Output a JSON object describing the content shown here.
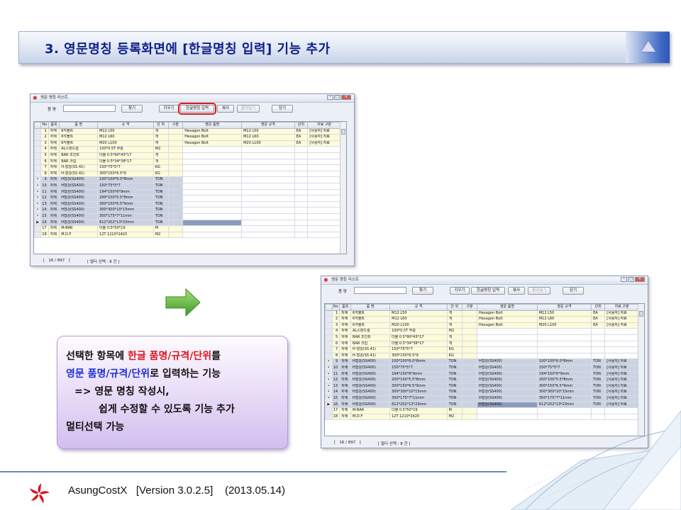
{
  "banner": {
    "title": "3. 영문명칭 등록화면에 [한글명칭 입력] 기능 추가",
    "collapse_icon": "triangle-up-icon"
  },
  "window": {
    "title": "영문 명칭 리스트",
    "name_label": "품 명",
    "buttons": {
      "find": "찾기",
      "clear": "지우기",
      "korean_input": "한글명칭 입력",
      "copy": "복사",
      "paste": "붙여넣기",
      "close": "닫기"
    },
    "columns": [
      "No",
      "품목",
      "품 명",
      "규 격",
      "단 위",
      "구분",
      "영문 품명",
      "영문 규격",
      "단위",
      "자료 구분"
    ],
    "rows": [
      {
        "no": "1",
        "cat": "자재",
        "name": "6각볼트",
        "spec": "M12 L50",
        "unit": "개",
        "div": "",
        "en_name": "Hexagon Bolt",
        "en_spec": "M12 L50",
        "en_unit": "EA",
        "src": "[사용자] 자료"
      },
      {
        "no": "2",
        "cat": "자재",
        "name": "6각볼트",
        "spec": "M12 L60",
        "unit": "개",
        "div": "",
        "en_name": "Hexagon Bolt",
        "en_spec": "M12 L60",
        "en_unit": "EA",
        "src": "[사용자] 자료"
      },
      {
        "no": "3",
        "cat": "자재",
        "name": "6각볼트",
        "spec": "M20 L100",
        "unit": "개",
        "div": "",
        "en_name": "Hexagon Bolt",
        "en_spec": "M20 L100",
        "en_unit": "EA",
        "src": "[사용자] 자료"
      },
      {
        "no": "4",
        "cat": "자재",
        "name": "AL스판드럴",
        "spec": "100*0.5T 무광",
        "unit": "M2",
        "div": "",
        "en_name": "",
        "en_spec": "",
        "en_unit": "",
        "src": ""
      },
      {
        "no": "5",
        "cat": "자재",
        "name": "BAR 조인트",
        "spec": "더블 0.5*90*43*17",
        "unit": "개",
        "div": "",
        "en_name": "",
        "en_spec": "",
        "en_unit": "",
        "src": ""
      },
      {
        "no": "6",
        "cat": "자재",
        "name": "BAR 크립",
        "spec": "더블 0.5*34*38*17",
        "unit": "개",
        "div": "",
        "en_name": "",
        "en_spec": "",
        "en_unit": "",
        "src": ""
      },
      {
        "no": "7",
        "cat": "자재",
        "name": "H-형강(SS 41)",
        "spec": "150*75*5*7",
        "unit": "KG",
        "div": "",
        "en_name": "",
        "en_spec": "",
        "en_unit": "",
        "src": ""
      },
      {
        "no": "8",
        "cat": "자재",
        "name": "H-형강(SS 41)",
        "spec": "300*150*6.5*9",
        "unit": "KG",
        "div": "",
        "en_name": "",
        "en_spec": "",
        "en_unit": "",
        "src": ""
      },
      {
        "no": "9",
        "cat": "자재",
        "name": "H형강(SS400)",
        "spec": "100*100*6.0*8mm",
        "unit": "TON",
        "div": "",
        "en_name": "H형강(SS400)",
        "en_spec": "100*100*6.0*8mm",
        "en_unit": "TON",
        "src": "[사용자] 자료"
      },
      {
        "no": "10",
        "cat": "자재",
        "name": "H형강(SS400)",
        "spec": "150*75*5*7",
        "unit": "TON",
        "div": "",
        "en_name": "H형강(SS400)",
        "en_spec": "150*75*5*7",
        "en_unit": "TON",
        "src": "[사용자] 자료"
      },
      {
        "no": "11",
        "cat": "자재",
        "name": "H형강(SS400)",
        "spec": "194*150*6*9mm",
        "unit": "TON",
        "div": "",
        "en_name": "H형강(SS400)",
        "en_spec": "194*150*6*9mm",
        "en_unit": "TON",
        "src": "[사용자] 자료"
      },
      {
        "no": "12",
        "cat": "자재",
        "name": "H형강(SS400)",
        "spec": "200*100*5.5*8mm",
        "unit": "TON",
        "div": "",
        "en_name": "H형강(SS400)",
        "en_spec": "200*100*5.5*8mm",
        "en_unit": "TON",
        "src": "[사용자] 자료"
      },
      {
        "no": "13",
        "cat": "자재",
        "name": "H형강(SS400)",
        "spec": "300*150*6.5*9mm",
        "unit": "TON",
        "div": "",
        "en_name": "H형강(SS400)",
        "en_spec": "300*150*6.5*9mm",
        "en_unit": "TON",
        "src": "[사용자] 자료"
      },
      {
        "no": "14",
        "cat": "자재",
        "name": "H형강(SS400)",
        "spec": "300*300*10*15mm",
        "unit": "TON",
        "div": "",
        "en_name": "H형강(SS400)",
        "en_spec": "300*300*10*15mm",
        "en_unit": "TON",
        "src": "[사용자] 자료"
      },
      {
        "no": "15",
        "cat": "자재",
        "name": "H형강(SS400)",
        "spec": "350*175*7*11mm",
        "unit": "TON",
        "div": "",
        "en_name": "H형강(SS400)",
        "en_spec": "350*175*7*11mm",
        "en_unit": "TON",
        "src": "[사용자] 자료"
      },
      {
        "no": "16",
        "cat": "자재",
        "name": "H형강(SS400)",
        "spec": "612*202*13*23mm",
        "unit": "TON",
        "div": "",
        "en_name": "H형강(SS400)",
        "en_spec": "612*202*13*23mm",
        "en_unit": "TON",
        "src": "[사용자] 자료"
      },
      {
        "no": "17",
        "cat": "자재",
        "name": "M-BAR",
        "spec": "더블 0.5*50*19",
        "unit": "M",
        "div": "",
        "en_name": "",
        "en_spec": "",
        "en_unit": "",
        "src": ""
      },
      {
        "no": "18",
        "cat": "자재",
        "name": "M.D.F",
        "spec": "12T 1210*2420",
        "unit": "M2",
        "div": "",
        "en_name": "",
        "en_spec": "",
        "en_unit": "",
        "src": ""
      }
    ],
    "status_count": "[   16 / 897   ]",
    "status_multi": "[ 멀티 선택 : 8 건 ]"
  },
  "note": {
    "l1_a": "선택한 항목에 ",
    "l1_b": "한글 품명/규격/단위",
    "l1_c": "를",
    "l2_a": "영문 품명/규격/단위",
    "l2_b": "로 입력하는 기능",
    "l3": "=>  영문 명칭 작성시,",
    "l4": "쉽게 수정할 수 있도록 기능 추가",
    "l5": "멀티선택 가능"
  },
  "footer": {
    "text": "AsungCostX   [Version 3.0.2.5]    (2013.05.14)",
    "logo": "asung-logo-icon"
  },
  "colors": {
    "banner_text": "#0d1f8a",
    "red_highlight": "#e0161c",
    "blue_highlight": "#1f2fd6",
    "arrow_green": "#5cb83a"
  }
}
